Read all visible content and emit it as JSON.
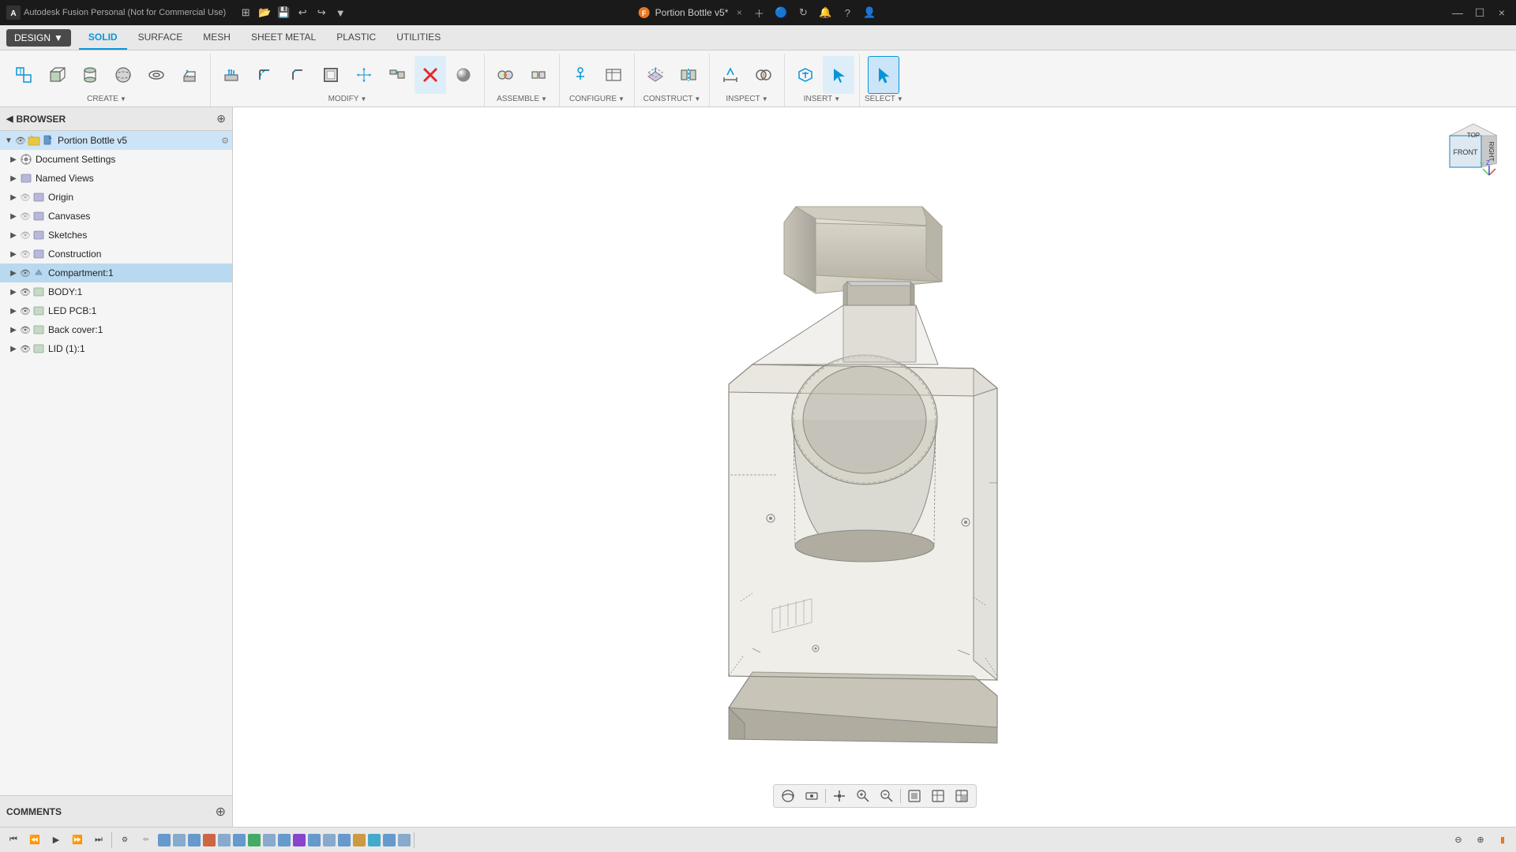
{
  "app": {
    "title": "Autodesk Fusion Personal (Not for Commercial Use)",
    "document_title": "Portion Bottle v5*",
    "close_x": "×",
    "minimize": "—",
    "maximize": "☐"
  },
  "tabs": {
    "active": "SOLID",
    "items": [
      "SOLID",
      "SURFACE",
      "MESH",
      "SHEET METAL",
      "PLASTIC",
      "UTILITIES"
    ]
  },
  "design_btn": "DESIGN",
  "ribbon": {
    "groups": [
      {
        "id": "create",
        "label": "CREATE",
        "has_arrow": true
      },
      {
        "id": "modify",
        "label": "MODIFY",
        "has_arrow": true
      },
      {
        "id": "assemble",
        "label": "ASSEMBLE",
        "has_arrow": true
      },
      {
        "id": "configure",
        "label": "CONFIGURE",
        "has_arrow": true
      },
      {
        "id": "construct",
        "label": "CONSTRUCT",
        "has_arrow": true
      },
      {
        "id": "inspect",
        "label": "INSPECT",
        "has_arrow": true
      },
      {
        "id": "insert",
        "label": "INSERT",
        "has_arrow": true
      },
      {
        "id": "select",
        "label": "SELECT",
        "has_arrow": true
      }
    ]
  },
  "browser": {
    "title": "BROWSER",
    "root_item": "Portion Bottle v5",
    "items": [
      {
        "id": "document-settings",
        "label": "Document Settings",
        "indent": 1,
        "has_expand": true,
        "icon": "gear"
      },
      {
        "id": "named-views",
        "label": "Named Views",
        "indent": 1,
        "has_expand": true,
        "icon": "folder"
      },
      {
        "id": "origin",
        "label": "Origin",
        "indent": 1,
        "has_expand": true,
        "icon": "folder",
        "has_visibility": true
      },
      {
        "id": "canvases",
        "label": "Canvases",
        "indent": 1,
        "has_expand": true,
        "icon": "folder",
        "has_visibility": true
      },
      {
        "id": "sketches",
        "label": "Sketches",
        "indent": 1,
        "has_expand": true,
        "icon": "folder",
        "has_visibility": true
      },
      {
        "id": "construction",
        "label": "Construction",
        "indent": 1,
        "has_expand": true,
        "icon": "folder",
        "has_visibility": true
      },
      {
        "id": "compartment1",
        "label": "Compartment:1",
        "indent": 1,
        "has_expand": true,
        "icon": "component",
        "has_visibility": true,
        "highlighted": true
      },
      {
        "id": "body1",
        "label": "BODY:1",
        "indent": 1,
        "has_expand": true,
        "icon": "folder",
        "has_visibility": true
      },
      {
        "id": "led-pcb1",
        "label": "LED PCB:1",
        "indent": 1,
        "has_expand": true,
        "icon": "folder",
        "has_visibility": true
      },
      {
        "id": "back-cover1",
        "label": "Back cover:1",
        "indent": 1,
        "has_expand": true,
        "icon": "folder",
        "has_visibility": true
      },
      {
        "id": "lid1",
        "label": "LID (1):1",
        "indent": 1,
        "has_expand": true,
        "icon": "folder",
        "has_visibility": true
      }
    ]
  },
  "comments": {
    "label": "COMMENTS"
  },
  "nav_cube": {
    "faces": [
      "TOP",
      "FRONT",
      "RIGHT"
    ]
  },
  "viewport_toolbar": {
    "buttons": [
      "orbit",
      "pan",
      "zoom-in",
      "zoom-out",
      "fit",
      "display",
      "grid",
      "more"
    ]
  },
  "bottom_playback": {
    "buttons": [
      "skip-start",
      "prev",
      "play",
      "next",
      "skip-end"
    ]
  }
}
